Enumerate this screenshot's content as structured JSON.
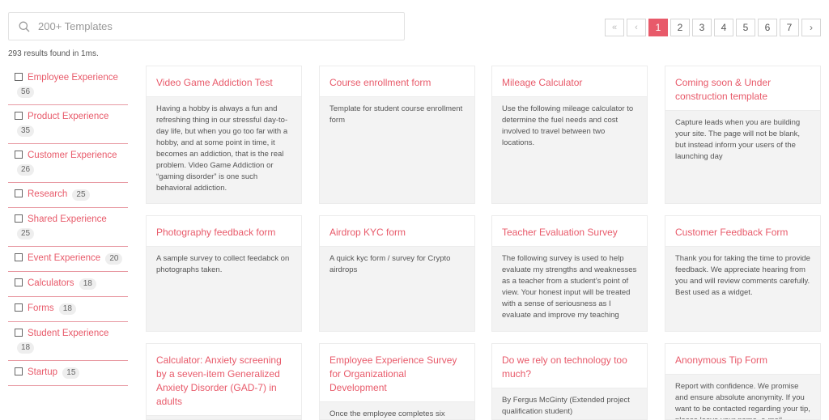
{
  "search": {
    "placeholder": "200+ Templates",
    "value": ""
  },
  "results_text": "293 results found in 1ms.",
  "pagination": {
    "first": "«",
    "prev": "‹",
    "pages": [
      "1",
      "2",
      "3",
      "4",
      "5",
      "6",
      "7"
    ],
    "current": "1",
    "next": "›"
  },
  "categories": [
    {
      "label": "Employee Experience",
      "count": "56"
    },
    {
      "label": "Product Experience",
      "count": "35"
    },
    {
      "label": "Customer Experience",
      "count": "26"
    },
    {
      "label": "Research",
      "count": "25"
    },
    {
      "label": "Shared Experience",
      "count": "25"
    },
    {
      "label": "Event Experience",
      "count": "20"
    },
    {
      "label": "Calculators",
      "count": "18"
    },
    {
      "label": "Forms",
      "count": "18"
    },
    {
      "label": "Student Experience",
      "count": "18"
    },
    {
      "label": "Startup",
      "count": "15"
    }
  ],
  "templates": [
    {
      "title": "Video Game Addiction Test",
      "description": "Having a hobby is always a fun and refreshing thing in our stressful day-to-day life, but when you go too far with a hobby, and at some point in time, it becomes an addiction, that is the real problem. Video Game Addiction or “gaming disorder” is one such behavioral addiction."
    },
    {
      "title": "Course enrollment form",
      "description": "Template for student course enrollment form"
    },
    {
      "title": "Mileage Calculator",
      "description": "Use the following mileage calculator to determine the fuel needs and cost involved to travel between two locations."
    },
    {
      "title": "Coming soon & Under construction template",
      "description": "Capture leads when you are building your site. The page will not be blank, but instead inform your users of the launching day"
    },
    {
      "title": "Photography feedback form",
      "description": "A sample survey to collect feedabck on photographs taken."
    },
    {
      "title": "Airdrop KYC form",
      "description": "A quick kyc form / survey for Crypto airdrops"
    },
    {
      "title": "Teacher Evaluation Survey",
      "description": "The following survey is used to help evaluate my strengths and weaknesses as a teacher from a student’s point of view. Your honest input will be treated with a sense of seriousness as I evaluate and improve my teaching"
    },
    {
      "title": "Customer Feedback Form",
      "description": "Thank you for taking the time to provide feedback. We appreciate hearing from you and will review comments carefully. Best used as a widget."
    },
    {
      "title": "Calculator: Anxiety screening by a seven-item Generalized Anxiety Disorder (GAD-7) in adults",
      "description": ""
    },
    {
      "title": "Employee Experience Survey for Organizational Development",
      "description": "Once the employee completes six months of tenure in the organization,"
    },
    {
      "title": "Do we rely on technology too much?",
      "description": "By Fergus McGinty (Extended project qualification student)"
    },
    {
      "title": "Anonymous Tip Form",
      "description": "Report with confidence. We promise and ensure absolute anonymity. If you want to be contacted regarding your tip, please leave your name, e-mail"
    }
  ],
  "colors": {
    "accent": "#e85a6a",
    "card_bg": "#f3f3f3",
    "divider": "#e89aa3"
  },
  "icons": {
    "search": "search-icon",
    "checkbox": "checkbox-icon"
  }
}
